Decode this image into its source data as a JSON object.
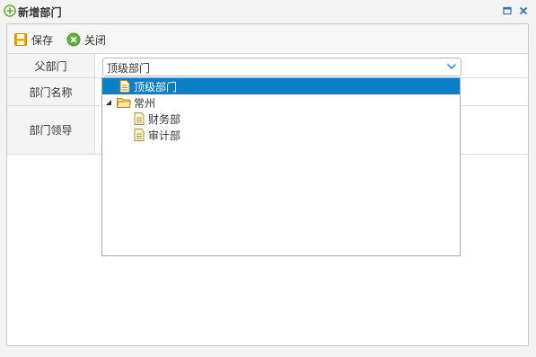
{
  "window": {
    "title": "新增部门"
  },
  "toolbar": {
    "save_label": "保存",
    "close_label": "关闭"
  },
  "form": {
    "parent_label": "父部门",
    "parent_value": "顶级部门",
    "name_label": "部门名称",
    "leader_label": "部门领导"
  },
  "tree": {
    "nodes": [
      {
        "label": "顶级部门",
        "selected": true
      },
      {
        "label": "常州",
        "expanded": true
      },
      {
        "label": "财务部"
      },
      {
        "label": "审计部"
      }
    ]
  },
  "colors": {
    "selection": "#0a7fc7",
    "save_icon": "#f0a800",
    "close_icon": "#61b042",
    "plus_icon": "#6aa82a"
  }
}
